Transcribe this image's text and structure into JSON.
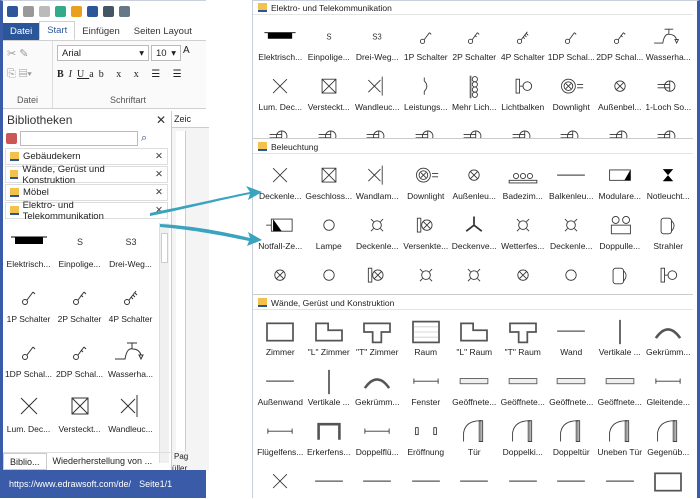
{
  "app": {
    "tabs": {
      "file": "Datei",
      "start": "Start",
      "insert": "Einfügen",
      "layout": "Seiten Layout"
    },
    "ribbon": {
      "group_file": "Datei",
      "group_font": "Schriftart",
      "font": "Arial",
      "size": "10"
    },
    "libraries": {
      "title": "Bibliotheken",
      "search_placeholder": "",
      "categories": [
        "Gebäudekern",
        "Wände, Gerüst und Konstruktion",
        "Möbel",
        "Elektro- und Telekommunikation"
      ],
      "items": [
        [
          "Elektrisch...",
          "panel"
        ],
        [
          "Einpolige...",
          "S"
        ],
        [
          "Drei-Weg...",
          "S3"
        ],
        [
          "1P Schalter",
          "sw1"
        ],
        [
          "2P Schalter",
          "sw2"
        ],
        [
          "4P Schalter",
          "sw4"
        ],
        [
          "1DP Schal...",
          "sw1"
        ],
        [
          "2DP Schal...",
          "sw2"
        ],
        [
          "Wasserha...",
          "water"
        ],
        [
          "Lum. Dec...",
          "x"
        ],
        [
          "Versteckt...",
          "boxx"
        ],
        [
          "Wandleuc...",
          "wallx"
        ]
      ]
    },
    "canvas_tab": "Zeic",
    "page_tab": "Pag",
    "fill_label": "üller",
    "bottom_tabs": [
      "Biblio...",
      "Wiederherstellung von ..."
    ],
    "status": {
      "url": "https://www.edrawsoft.com/de/",
      "page": "Seite1/1"
    }
  },
  "panel": {
    "sections": [
      {
        "title": "Elektro- und Telekommunikation",
        "items": [
          [
            "Elektrisch...",
            "panel"
          ],
          [
            "Einpolige...",
            "S"
          ],
          [
            "Drei-Weg...",
            "S3"
          ],
          [
            "1P Schalter",
            "sw1"
          ],
          [
            "2P Schalter",
            "sw2"
          ],
          [
            "4P Schalter",
            "sw4"
          ],
          [
            "1DP Schal...",
            "sw1"
          ],
          [
            "2DP Schal...",
            "sw2"
          ],
          [
            "Wasserha...",
            "water"
          ],
          [
            "Lum. Dec...",
            "x"
          ],
          [
            "Versteckt...",
            "boxx"
          ],
          [
            "Wandleuc...",
            "wallx"
          ],
          [
            "Leistungs...",
            "paren"
          ],
          [
            "Mehr Lich...",
            "multi"
          ],
          [
            "Lichtbalken",
            "bar"
          ],
          [
            "Downlight",
            "down"
          ],
          [
            "Außenbel...",
            "cx"
          ],
          [
            "1-Loch So...",
            "sock"
          ],
          [
            "",
            "sock"
          ],
          [
            "",
            "sock"
          ],
          [
            "",
            "sock"
          ],
          [
            "",
            "sock"
          ],
          [
            "",
            "sock"
          ],
          [
            "",
            "sock"
          ],
          [
            "",
            "sock"
          ],
          [
            "",
            "sock"
          ],
          [
            "",
            "sock"
          ]
        ]
      },
      {
        "title": "Beleuchtung",
        "items": [
          [
            "Deckenle...",
            "x"
          ],
          [
            "Geschloss...",
            "boxx"
          ],
          [
            "Wandlam...",
            "wallx"
          ],
          [
            "Downlight",
            "down"
          ],
          [
            "Außenleu...",
            "cx"
          ],
          [
            "Badezim...",
            "bath"
          ],
          [
            "Balkenleu...",
            "line"
          ],
          [
            "Modulare...",
            "mod"
          ],
          [
            "Notleucht...",
            "hour"
          ],
          [
            "Notfall-Ze...",
            "emerg"
          ],
          [
            "Lampe",
            "circ"
          ],
          [
            "Deckenle...",
            "ceil"
          ],
          [
            "Versenkte...",
            "rec"
          ],
          [
            "Deckenve...",
            "fan"
          ],
          [
            "Wetterfes...",
            "ceil"
          ],
          [
            "Deckenle...",
            "ceil"
          ],
          [
            "Doppulle...",
            "dbl"
          ],
          [
            "Strahler",
            "spot"
          ],
          [
            "",
            "cx"
          ],
          [
            "",
            "circ"
          ],
          [
            "",
            "rec"
          ],
          [
            "",
            "ceil"
          ],
          [
            "",
            "ceil"
          ],
          [
            "",
            "cx"
          ],
          [
            "",
            "circ"
          ],
          [
            "",
            "spot"
          ],
          [
            "",
            "bar"
          ]
        ]
      },
      {
        "title": "Wände, Gerüst und Konstruktion",
        "items": [
          [
            "Zimmer",
            "room"
          ],
          [
            "\"L\" Zimmer",
            "lroom"
          ],
          [
            "\"T\" Zimmer",
            "troom"
          ],
          [
            "Raum",
            "raum"
          ],
          [
            "\"L\" Raum",
            "lroom"
          ],
          [
            "\"T\" Raum",
            "troom"
          ],
          [
            "Wand",
            "line"
          ],
          [
            "Vertikale ...",
            "vline"
          ],
          [
            "Gekrümm...",
            "arc"
          ],
          [
            "Außenwand",
            "line"
          ],
          [
            "Vertikale ...",
            "vline"
          ],
          [
            "Gekrümm...",
            "arc"
          ],
          [
            "Fenster",
            "win"
          ],
          [
            "Geöffnete...",
            "dwin"
          ],
          [
            "Geöffnete...",
            "dwin"
          ],
          [
            "Geöffnete...",
            "dwin"
          ],
          [
            "Geöffnete...",
            "dwin"
          ],
          [
            "Gleitende...",
            "win"
          ],
          [
            "Flügelfens...",
            "win"
          ],
          [
            "Erkerfens...",
            "bay"
          ],
          [
            "Doppelflü...",
            "win"
          ],
          [
            "Eröffnung",
            "open"
          ],
          [
            "Tür",
            "door"
          ],
          [
            "Doppelki...",
            "door"
          ],
          [
            "Doppeltür",
            "door"
          ],
          [
            "Uneben Tür",
            "door"
          ],
          [
            "Gegenüb...",
            "door"
          ],
          [
            "",
            "x"
          ],
          [
            "",
            "line"
          ],
          [
            "",
            "line"
          ],
          [
            "",
            "line"
          ],
          [
            "",
            "line"
          ],
          [
            "",
            "line"
          ],
          [
            "",
            "line"
          ],
          [
            "",
            "line"
          ],
          [
            "",
            "room"
          ]
        ]
      }
    ]
  },
  "colors": {
    "accent": "#2b579a",
    "status": "#3a5ba8",
    "arrow": "#3aa3bd"
  }
}
